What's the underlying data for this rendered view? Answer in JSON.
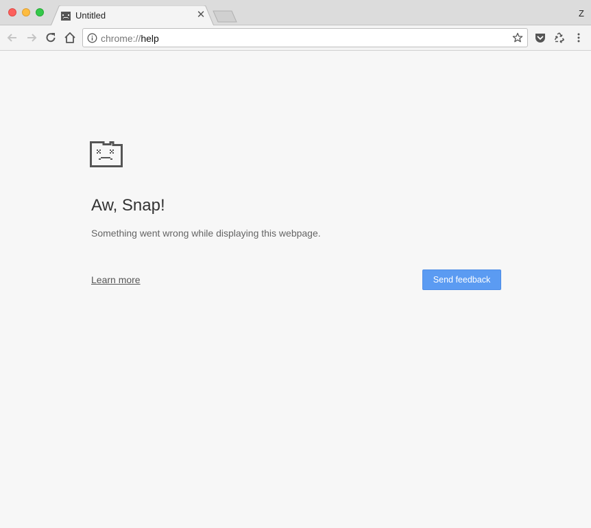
{
  "window": {
    "controls": [
      "close",
      "minimize",
      "zoom"
    ],
    "profile_label": "Z"
  },
  "tab": {
    "title": "Untitled",
    "favicon": "sad-tab-icon",
    "close_icon": "close-icon"
  },
  "toolbar": {
    "back_icon": "arrow-left-icon",
    "forward_icon": "arrow-right-icon",
    "reload_icon": "reload-icon",
    "home_icon": "home-icon",
    "url_scheme": "chrome://",
    "url_host": "help",
    "info_icon": "info-icon",
    "bookmark_icon": "star-icon",
    "extensions": [
      "pocket-icon",
      "recycle-icon"
    ],
    "menu_icon": "kebab-menu-icon"
  },
  "error": {
    "icon": "sad-tab-icon",
    "heading": "Aw, Snap!",
    "message": "Something went wrong while displaying this webpage.",
    "learn_more": "Learn more",
    "feedback_button": "Send feedback"
  },
  "colors": {
    "page_background": "#f7f7f7",
    "button_blue": "#5b9bf2",
    "titlebar": "#dcdcdc"
  }
}
